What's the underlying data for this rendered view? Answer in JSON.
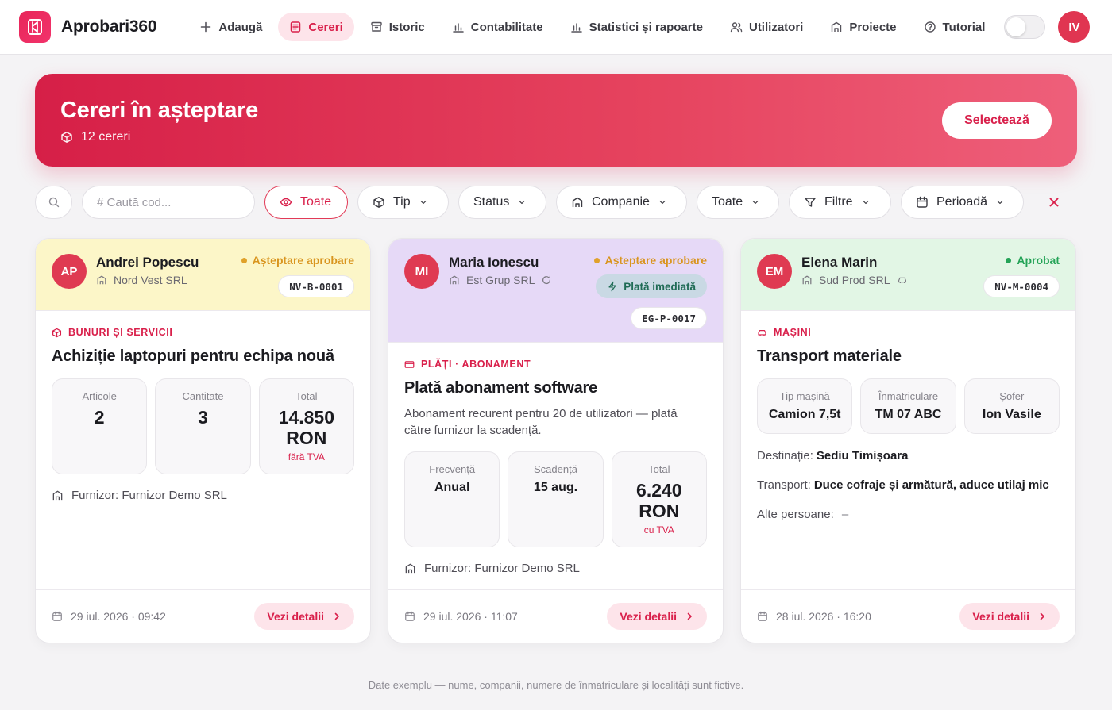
{
  "app": {
    "title": "Aprobari360",
    "user_initials": "IV"
  },
  "nav": [
    {
      "label": "Adaugă",
      "icon": "plus-icon"
    },
    {
      "label": "Cereri",
      "icon": "document-icon",
      "active": true
    },
    {
      "label": "Istoric",
      "icon": "archive-icon"
    },
    {
      "label": "Contabilitate",
      "icon": "bar-chart-icon"
    },
    {
      "label": "Statistici și rapoarte",
      "icon": "bar-chart-icon"
    },
    {
      "label": "Utilizatori",
      "icon": "users-icon"
    },
    {
      "label": "Proiecte",
      "icon": "building-icon"
    },
    {
      "label": "Tutorial",
      "icon": "help-circle-icon"
    }
  ],
  "hero": {
    "title": "Cereri în așteptare",
    "count_label": "12 cereri",
    "select_label": "Selectează"
  },
  "filters": {
    "search_placeholder": "# Caută cod...",
    "all_label": "Toate",
    "type_label": "Tip",
    "status_label": "Status",
    "company_label": "Companie",
    "all2_label": "Toate",
    "filters_label": "Filtre",
    "period_label": "Perioadă"
  },
  "colors": {
    "accent": "#d9204b",
    "card1_head": "#fcf6c8",
    "card2_head": "#e6d9f7",
    "card3_head": "#e2f6e5",
    "pending": "#e0a12a",
    "approved": "#24a357"
  },
  "cards": [
    {
      "initials": "AP",
      "name": "Andrei Popescu",
      "company": "Nord Vest SRL",
      "status": "Așteptare aprobare",
      "code": "NV-B-0001",
      "category": "BUNURI ȘI SERVICII",
      "title": "Achiziție laptopuri pentru echipa nouă",
      "stats": [
        {
          "label": "Articole",
          "value": "2"
        },
        {
          "label": "Cantitate",
          "value": "3"
        },
        {
          "label": "Total",
          "value": "14.850",
          "unit": "RON",
          "sub": "fără TVA"
        }
      ],
      "supplier": "Furnizor: Furnizor Demo SRL",
      "date": "29 iul. 2026 · 09:42",
      "details_label": "Vezi detalii"
    },
    {
      "initials": "MI",
      "name": "Maria Ionescu",
      "company": "Est Grup SRL",
      "status": "Așteptare aprobare",
      "badge": "Plată imediată",
      "code": "EG-P-0017",
      "category": "PLĂȚI · ABONAMENT",
      "title": "Plată abonament software",
      "description": "Abonament recurent pentru 20 de utilizatori — plată către furnizor la scadență.",
      "stats": [
        {
          "label": "Frecvență",
          "value": "Anual"
        },
        {
          "label": "Scadență",
          "value": "15 aug."
        },
        {
          "label": "Total",
          "value": "6.240",
          "unit": "RON",
          "sub": "cu TVA"
        }
      ],
      "supplier": "Furnizor: Furnizor Demo SRL",
      "date": "29 iul. 2026 · 11:07",
      "details_label": "Vezi detalii"
    },
    {
      "initials": "EM",
      "name": "Elena Marin",
      "company": "Sud Prod SRL",
      "status": "Aprobat",
      "code": "NV-M-0004",
      "category": "MAȘINI",
      "title": "Transport materiale",
      "stats": [
        {
          "label": "Tip mașină",
          "value": "Camion 7,5t"
        },
        {
          "label": "Înmatriculare",
          "value": "TM 07 ABC"
        },
        {
          "label": "Șofer",
          "value": "Ion Vasile"
        }
      ],
      "destination_label": "Destinație:",
      "destination": "Sediu Timișoara",
      "transport_label": "Transport:",
      "transport": "Duce cofraje și armătură, aduce utilaj mic",
      "others_label": "Alte persoane:",
      "others": "–",
      "date": "28 iul. 2026 · 16:20",
      "details_label": "Vezi detalii"
    }
  ],
  "footnote": "Date exemplu — nume, companii, numere de înmatriculare și localități sunt fictive."
}
